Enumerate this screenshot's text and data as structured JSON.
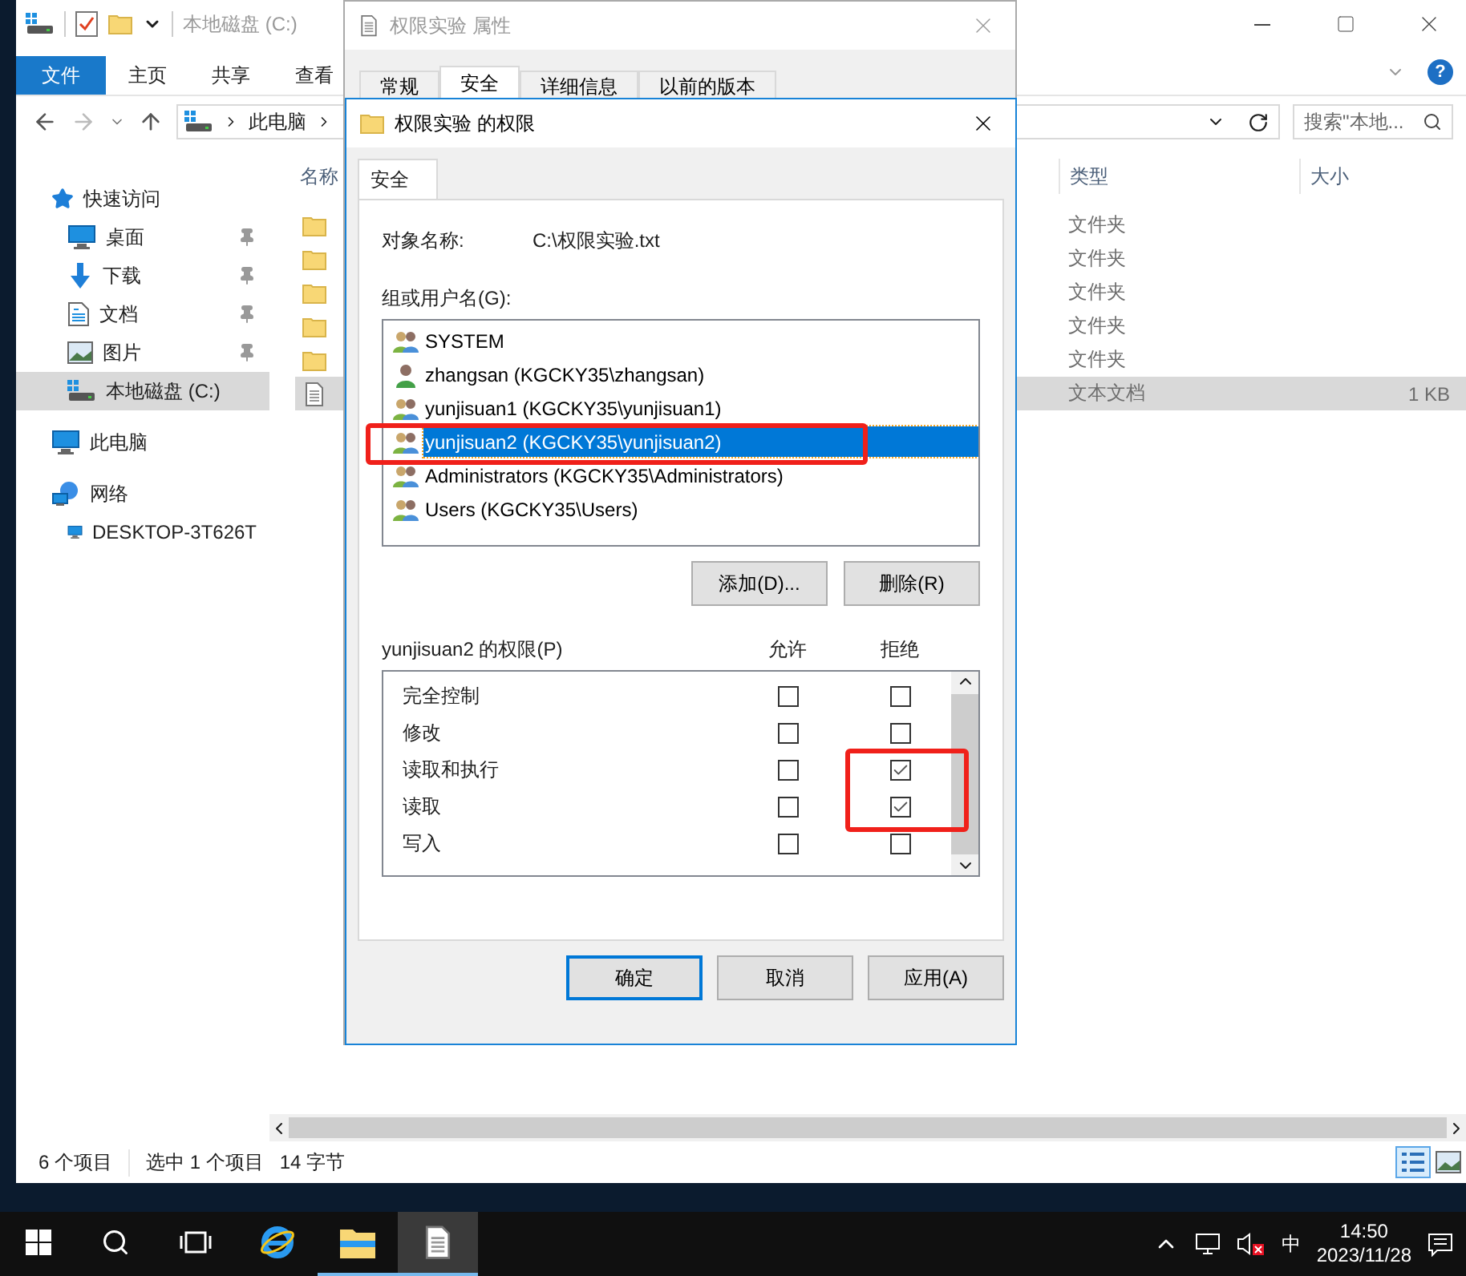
{
  "explorer": {
    "title": "本地磁盘 (C:)",
    "ribbon_tabs": [
      {
        "label": "文件",
        "selected": true
      },
      {
        "label": "主页",
        "selected": false
      },
      {
        "label": "共享",
        "selected": false
      },
      {
        "label": "查看",
        "selected": false
      }
    ],
    "help": "?",
    "address": [
      "此电脑"
    ],
    "search": {
      "placeholder": "搜索\"本地..."
    },
    "sidebar": [
      {
        "label": "快速访问",
        "kind": "star",
        "selected": false,
        "children": [
          {
            "label": "桌面",
            "kind": "desktop",
            "pinned": true,
            "selected": false
          },
          {
            "label": "下载",
            "kind": "download",
            "pinned": true,
            "selected": false
          },
          {
            "label": "文档",
            "kind": "document",
            "pinned": true,
            "selected": false
          },
          {
            "label": "图片",
            "kind": "picture",
            "pinned": true,
            "selected": false
          },
          {
            "label": "本地磁盘 (C:)",
            "kind": "drive",
            "pinned": false,
            "selected": true
          }
        ]
      },
      {
        "label": "此电脑",
        "kind": "pc",
        "selected": false
      },
      {
        "label": "网络",
        "kind": "network",
        "selected": false,
        "children": [
          {
            "label": "DESKTOP-3T626T",
            "kind": "pc",
            "pinned": false,
            "selected": false
          }
        ]
      }
    ],
    "columns": [
      "名称",
      "类型",
      "大小"
    ],
    "files": [
      {
        "kind": "folder",
        "type": "文件夹",
        "selected": false
      },
      {
        "kind": "folder",
        "type": "文件夹",
        "selected": false
      },
      {
        "kind": "folder",
        "type": "文件夹",
        "selected": false
      },
      {
        "kind": "folder",
        "type": "文件夹",
        "selected": false
      },
      {
        "kind": "folder",
        "type": "文件夹",
        "selected": false
      },
      {
        "kind": "text",
        "type": "文本文档",
        "size": "1 KB",
        "selected": true
      }
    ],
    "status": [
      "6 个项目",
      "选中 1 个项目",
      "14 字节"
    ]
  },
  "properties_dialog": {
    "title": "权限实验 属性",
    "tabs": [
      {
        "label": "常规",
        "selected": false
      },
      {
        "label": "安全",
        "selected": true
      },
      {
        "label": "详细信息",
        "selected": false
      },
      {
        "label": "以前的版本",
        "selected": false
      }
    ]
  },
  "permissions_dialog": {
    "title": "权限实验 的权限",
    "tab": "安全",
    "object_label": "对象名称:",
    "object_value": "C:\\权限实验.txt",
    "users_label": "组或用户名(G):",
    "users": [
      {
        "name": "SYSTEM",
        "kind": "group",
        "selected": false
      },
      {
        "name": "zhangsan (KGCKY35\\zhangsan)",
        "kind": "user",
        "selected": false
      },
      {
        "name": "yunjisuan1 (KGCKY35\\yunjisuan1)",
        "kind": "group",
        "selected": false
      },
      {
        "name": "yunjisuan2 (KGCKY35\\yunjisuan2)",
        "kind": "group",
        "selected": true
      },
      {
        "name": "Administrators (KGCKY35\\Administrators)",
        "kind": "group",
        "selected": false
      },
      {
        "name": "Users (KGCKY35\\Users)",
        "kind": "group",
        "selected": false
      }
    ],
    "user_buttons": [
      "添加(D)...",
      "删除(R)"
    ],
    "perm_label": "yunjisuan2 的权限(P)",
    "allow_header": "允许",
    "deny_header": "拒绝",
    "permissions": [
      {
        "name": "完全控制",
        "allow": false,
        "deny": false,
        "disabled": false
      },
      {
        "name": "修改",
        "allow": false,
        "deny": false,
        "disabled": false
      },
      {
        "name": "读取和执行",
        "allow": false,
        "deny": true,
        "disabled": false
      },
      {
        "name": "读取",
        "allow": false,
        "deny": true,
        "disabled": false
      },
      {
        "name": "写入",
        "allow": false,
        "deny": false,
        "disabled": false
      }
    ],
    "buttons": [
      {
        "label": "确定",
        "default": true
      },
      {
        "label": "取消",
        "default": false
      },
      {
        "label": "应用(A)",
        "default": false
      }
    ]
  },
  "annotations": [
    {
      "kind": "red_box"
    },
    {
      "kind": "red_box"
    }
  ],
  "taskbar": {
    "apps": [
      {
        "kind": "browser",
        "running": false,
        "selected": false
      },
      {
        "kind": "explorer",
        "running": true,
        "selected": false
      },
      {
        "kind": "notepad",
        "running": true,
        "selected": true
      }
    ],
    "ime": "中",
    "time": "14:50",
    "date": "2023/11/28"
  }
}
